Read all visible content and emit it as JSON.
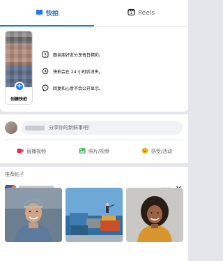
{
  "tabs": [
    {
      "label": "快拍",
      "active": true,
      "icon": "book-icon"
    },
    {
      "label": "Reels",
      "active": false,
      "icon": "reels-icon"
    }
  ],
  "stories": {
    "create_label": "创建快拍",
    "features": [
      {
        "icon": "clock-icon",
        "text": "跟亲朋好友分享每日精彩。"
      },
      {
        "icon": "timer-icon",
        "text": "快拍会在 24 小时后消失。"
      },
      {
        "icon": "messenger-icon",
        "text": "回复和心意不会公开显示。"
      }
    ]
  },
  "composer": {
    "placeholder": "分享你的新鲜事吧！",
    "actions": [
      {
        "label": "直播视频",
        "icon": "live-video-icon",
        "color": "#f02849"
      },
      {
        "label": "照片/视频",
        "icon": "photo-icon",
        "color": "#45bd62"
      },
      {
        "label": "感受/活动",
        "icon": "feeling-icon",
        "color": "#f7b928"
      }
    ]
  },
  "suggested": {
    "title": "推荐帖子",
    "more_label": "···",
    "close_label": "✕"
  },
  "colors": {
    "accent": "#1877f2",
    "background": "#e4e6eb"
  }
}
